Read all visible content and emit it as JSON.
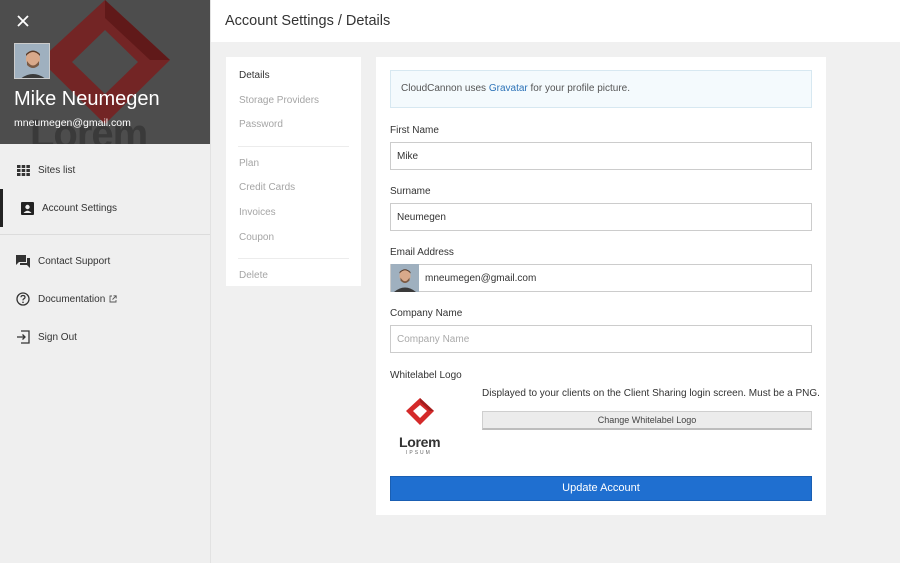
{
  "profile": {
    "name": "Mike Neumegen",
    "email": "mneumegen@gmail.com",
    "bg_logo_text": "Lorem"
  },
  "sidebar": {
    "items": [
      {
        "label": "Sites list",
        "icon": "grid-icon",
        "active": false
      },
      {
        "label": "Account Settings",
        "icon": "account-box-icon",
        "active": true
      },
      {
        "label": "Contact Support",
        "icon": "chat-icon",
        "active": false
      },
      {
        "label": "Documentation",
        "icon": "help-circle-icon",
        "active": false
      },
      {
        "label": "Sign Out",
        "icon": "exit-icon",
        "active": false
      }
    ]
  },
  "header": {
    "title": "Account Settings / Details"
  },
  "subnav": {
    "group1": [
      "Details",
      "Storage Providers",
      "Password"
    ],
    "group2": [
      "Plan",
      "Credit Cards",
      "Invoices",
      "Coupon"
    ],
    "group3": [
      "Delete"
    ]
  },
  "notice": {
    "prefix": "CloudCannon uses ",
    "link": "Gravatar",
    "suffix": " for your profile picture."
  },
  "form": {
    "first_name_label": "First Name",
    "first_name_value": "Mike",
    "surname_label": "Surname",
    "surname_value": "Neumegen",
    "email_label": "Email Address",
    "email_value": "mneumegen@gmail.com",
    "company_label": "Company Name",
    "company_placeholder": "Company Name",
    "company_value": "",
    "whitelabel_label": "Whitelabel Logo",
    "whitelabel_desc": "Displayed to your clients on the Client Sharing login screen. Must be a PNG.",
    "logo_text": "Lorem",
    "logo_subtext": "IPSUM",
    "change_logo_button": "Change Whitelabel Logo",
    "update_button": "Update Account"
  },
  "colors": {
    "primary_button": "#1f6fd0",
    "link": "#2d73b8",
    "logo_red": "#d42a2a",
    "profile_bg": "#4d4d4d"
  }
}
